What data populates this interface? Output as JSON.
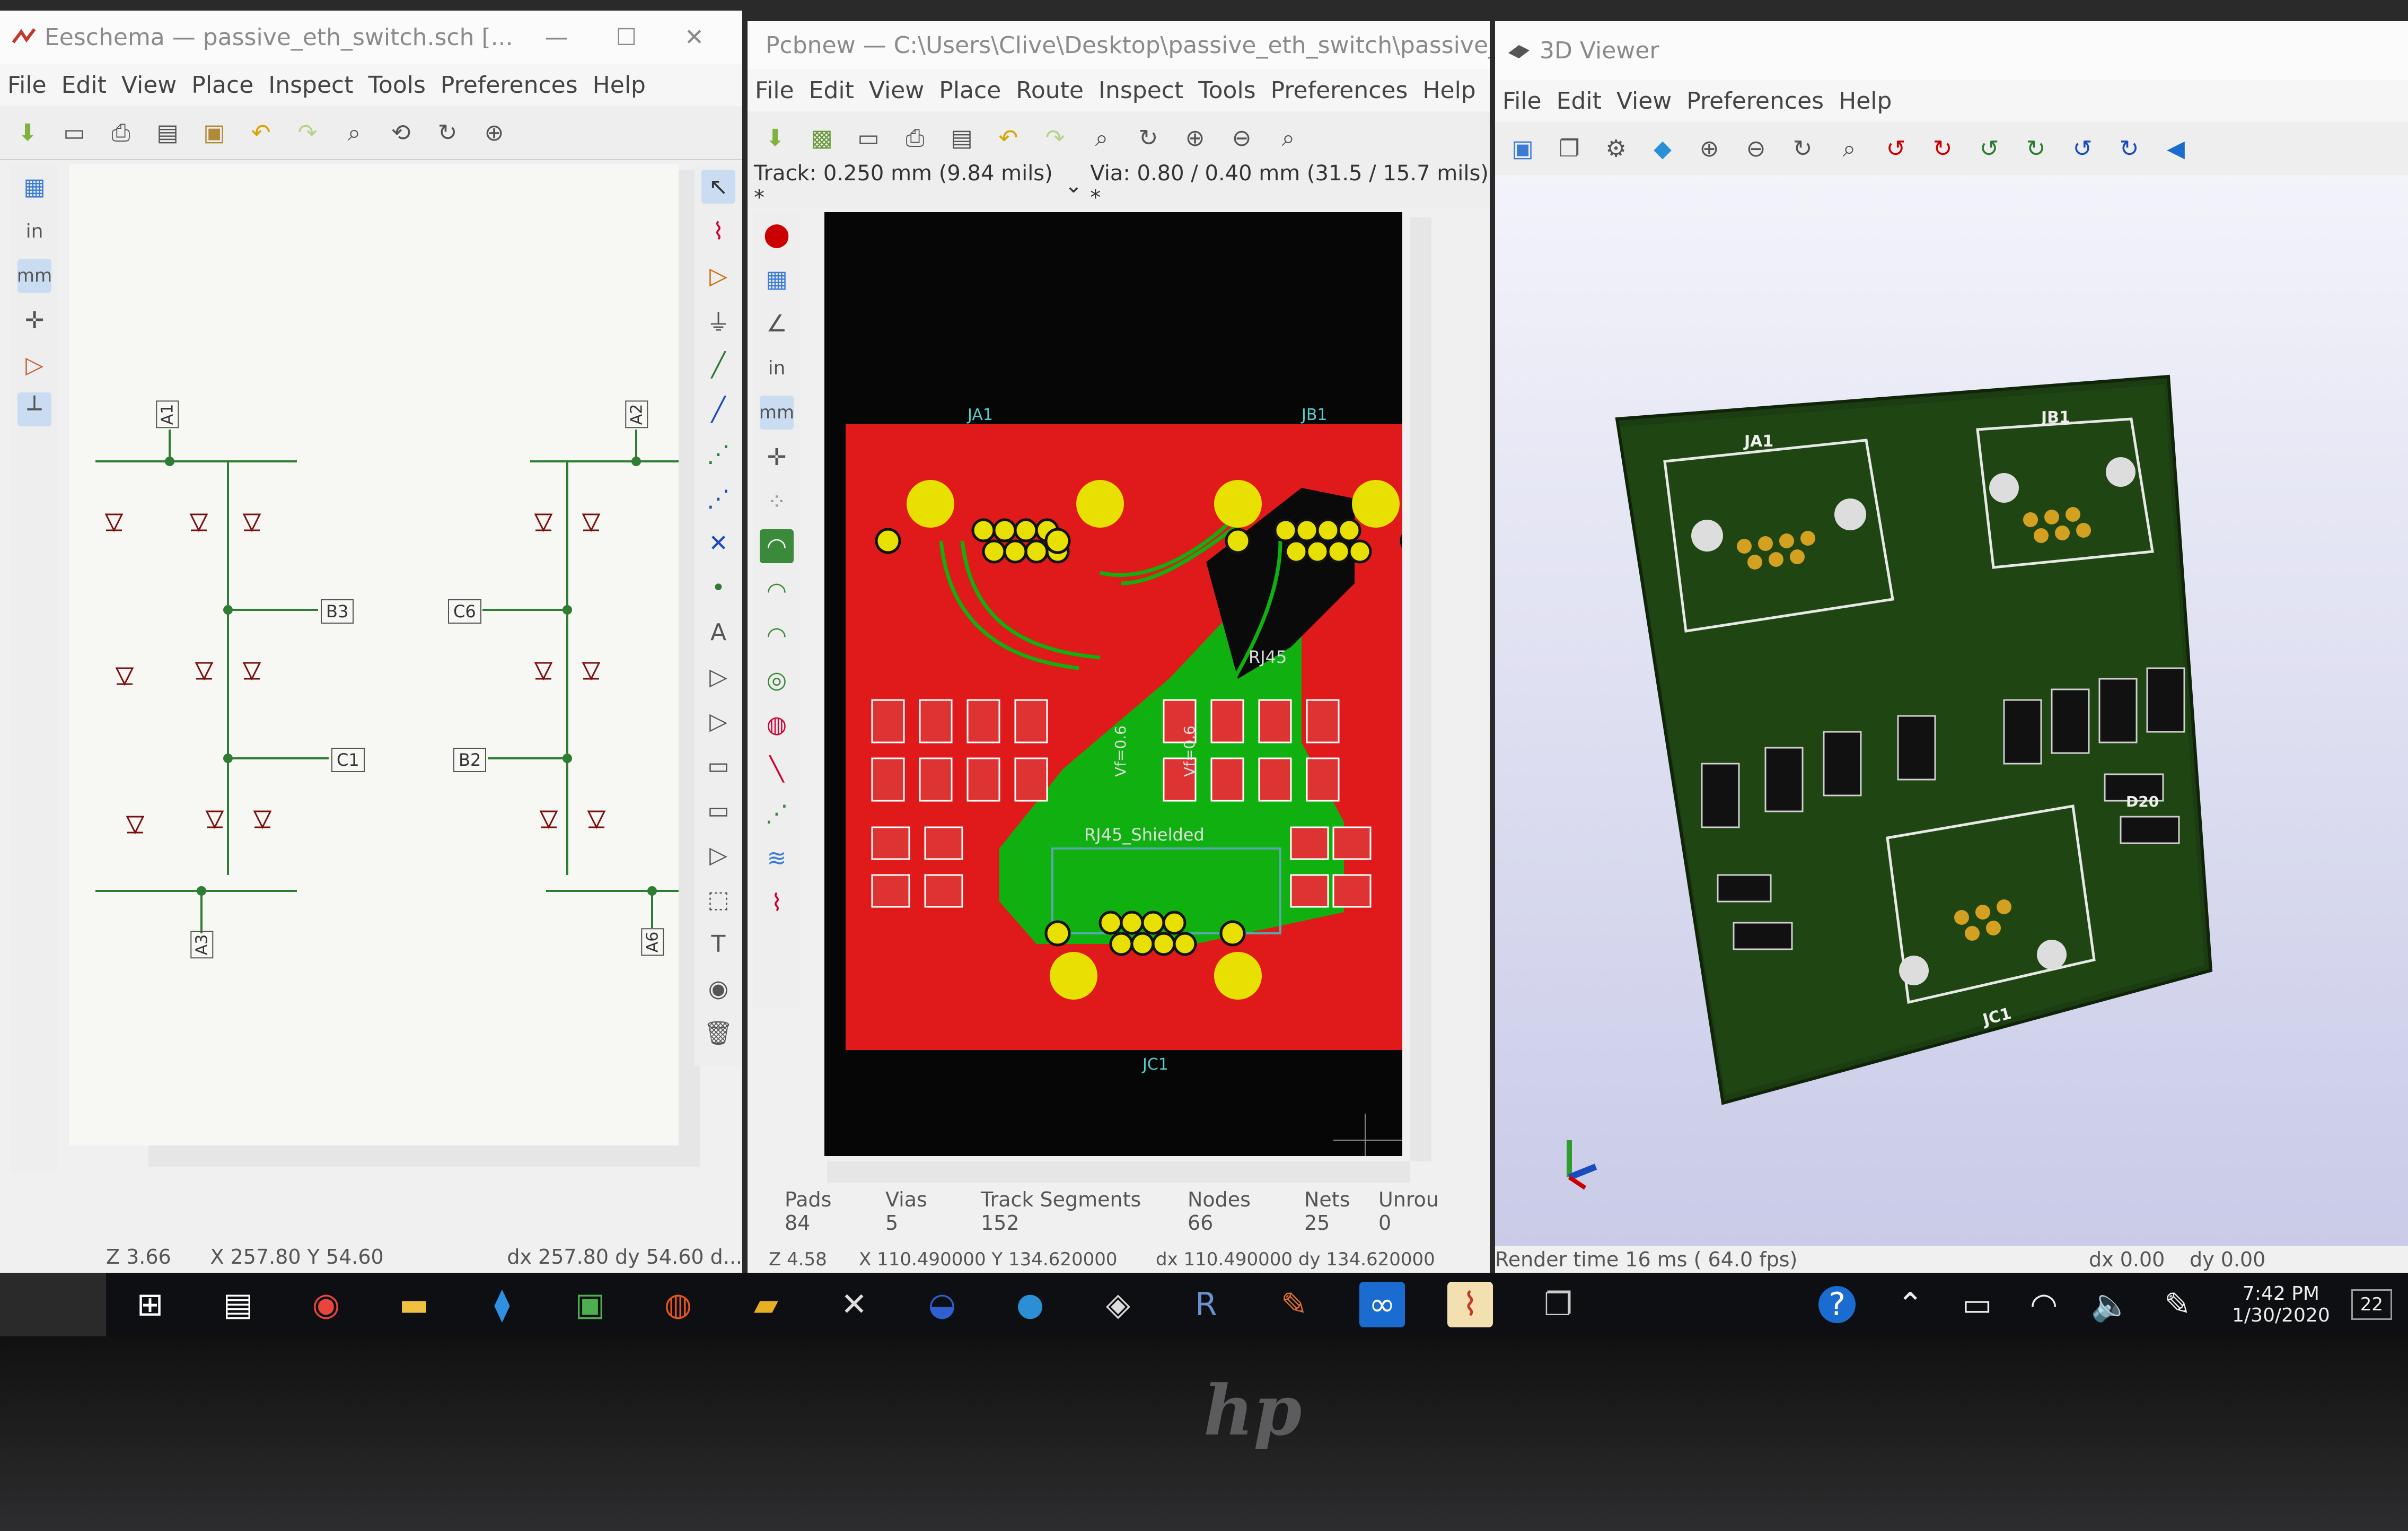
{
  "eeschema": {
    "title": "Eeschema — passive_eth_switch.sch [...",
    "menu": [
      "File",
      "Edit",
      "View",
      "Place",
      "Inspect",
      "Tools",
      "Preferences",
      "Help"
    ],
    "left_tools": [
      "in",
      "mm"
    ],
    "labels": {
      "a1": "A1",
      "a2": "A2",
      "b3": "B3",
      "c6": "C6",
      "c1": "C1",
      "b2": "B2",
      "a3": "A3",
      "a6": "A6"
    },
    "status": {
      "zoom": "Z 3.66",
      "xy": "X 257.80  Y 54.60",
      "dxdy": "dx 257.80  dy 54.60  d..."
    }
  },
  "pcbnew": {
    "title": "Pcbnew — C:\\Users\\Clive\\Desktop\\passive_eth_switch\\passive_eth_s",
    "menu": [
      "File",
      "Edit",
      "View",
      "Place",
      "Route",
      "Inspect",
      "Tools",
      "Preferences",
      "Help"
    ],
    "track": "Track: 0.250 mm (9.84 mils) *",
    "via": "Via: 0.80 / 0.40 mm (31.5 / 15.7 mils) *",
    "left_tools": [
      "in",
      "mm"
    ],
    "board_labels": {
      "ja1": "JA1",
      "jb1": "JB1",
      "jc1": "JC1",
      "rj45": "RJ45",
      "rj45s": "RJ45_Shielded",
      "vf1": "Vf=0.6",
      "vf2": "Vf=0.6"
    },
    "stats": [
      {
        "label": "Pads",
        "value": "84"
      },
      {
        "label": "Vias",
        "value": "5"
      },
      {
        "label": "Track Segments",
        "value": "152"
      },
      {
        "label": "Nodes",
        "value": "66"
      },
      {
        "label": "Nets",
        "value": "25"
      },
      {
        "label": "Unrou",
        "value": "0"
      }
    ],
    "status": {
      "zoom": "Z 4.58",
      "xy": "X 110.490000  Y 134.620000",
      "dxdy": "dx 110.490000  dy 134.620000"
    }
  },
  "viewer3d": {
    "title": "3D Viewer",
    "menu": [
      "File",
      "Edit",
      "View",
      "Preferences",
      "Help"
    ],
    "board_labels": {
      "ja1": "JA1",
      "jb1": "JB1",
      "jc1": "JC1",
      "d20": "D20"
    },
    "status": {
      "render": "Render time 16 ms ( 64.0 fps)",
      "dx": "dx 0.00",
      "dy": "dy 0.00"
    }
  },
  "taskbar": {
    "time": "7:42 PM",
    "date": "1/30/2020",
    "notif": "22",
    "icons": [
      "start-icon",
      "task-view-icon",
      "chrome-icon",
      "file-explorer-icon",
      "vscode-icon",
      "image-app-icon",
      "ubuntu-icon",
      "pdf-icon",
      "xming-icon",
      "app-icon-blue",
      "musescore-icon",
      "box-3d-icon",
      "r-icon",
      "pencil-app-icon",
      "app-icon-active",
      "kicad-icon",
      "window-app-icon"
    ]
  },
  "colors": {
    "pcb_red": "#e01a1a",
    "pcb_green": "#10b010",
    "pad_yellow": "#e8e000",
    "board3d": "#1f4513",
    "schematic_wire": "#2e7d32",
    "schematic_part": "#7a1010"
  },
  "brand": "hp"
}
